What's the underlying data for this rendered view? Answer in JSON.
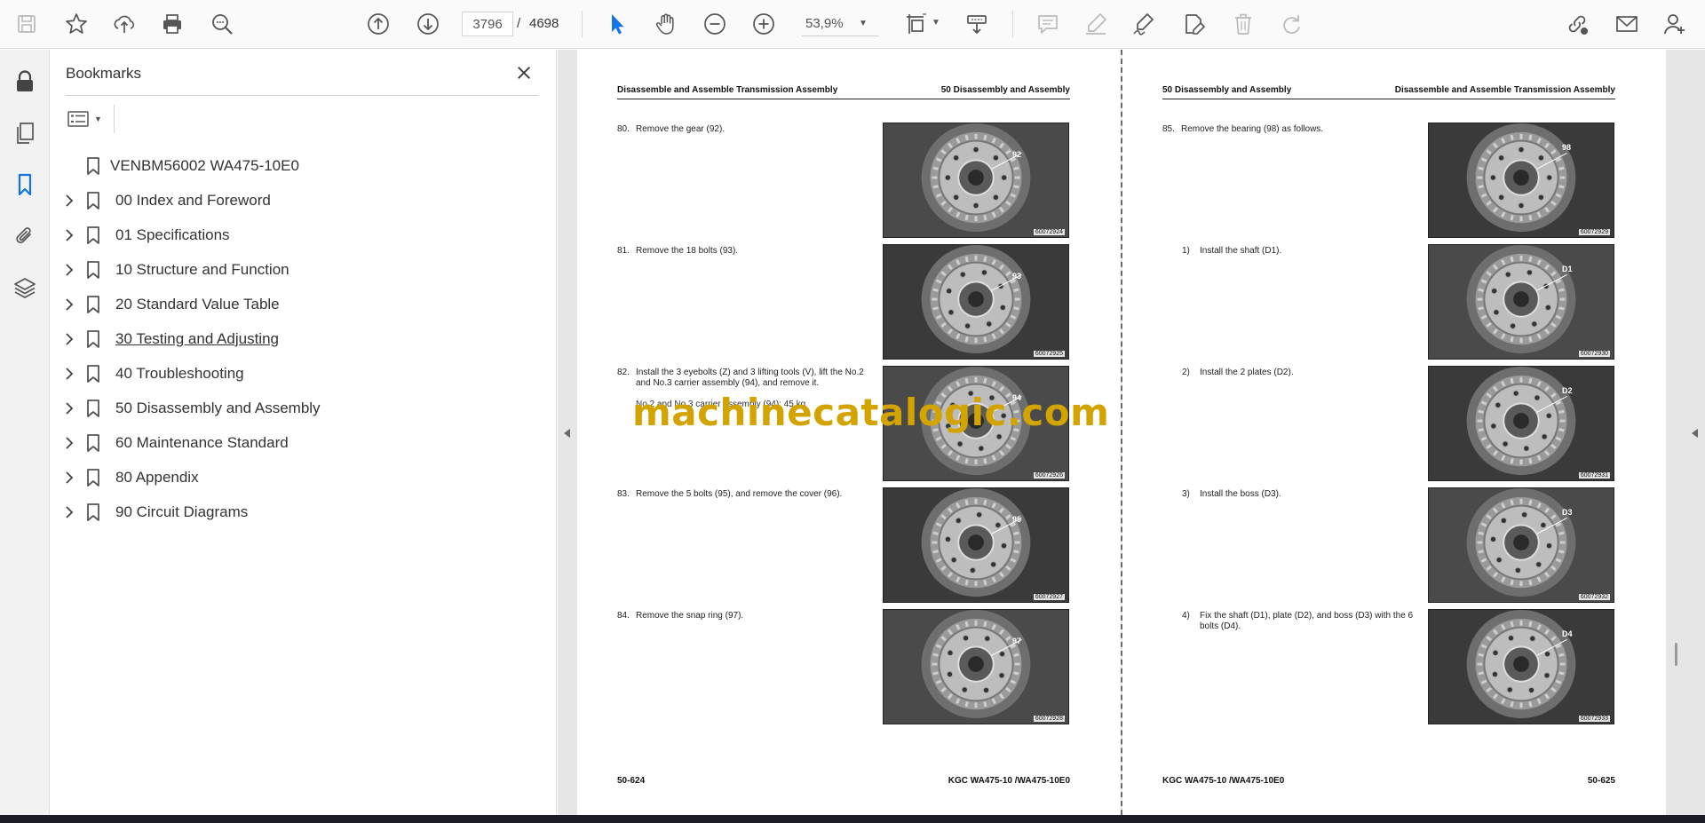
{
  "toolbar": {
    "icons": [
      "save-icon",
      "star-icon",
      "upload-icon",
      "print-icon",
      "zoom-search-icon",
      "page-up-icon",
      "page-down-icon",
      "select-cursor-icon",
      "hand-icon",
      "zoom-out-icon",
      "zoom-in-icon",
      "fit-page-icon",
      "scroll-mode-icon",
      "comment-icon",
      "highlight-icon",
      "sign-icon",
      "edit-text-icon",
      "delete-icon",
      "redo-icon",
      "share-link-icon",
      "email-icon",
      "account-icon"
    ],
    "current_page": "3796",
    "page_separator": "/",
    "total_pages": "4698",
    "zoom": "53,9%"
  },
  "rail": {
    "icons": [
      "lock-icon",
      "copy-pages-icon",
      "bookmark-icon",
      "attachment-icon",
      "layers-icon"
    ],
    "active": "bookmark-icon"
  },
  "bookmarks": {
    "title": "Bookmarks",
    "root": "VENBM56002 WA475-10E0",
    "items": [
      "00 Index and Foreword",
      "01 Specifications",
      "10 Structure and Function",
      "20 Standard Value Table",
      "30 Testing and Adjusting",
      "40 Troubleshooting",
      "50 Disassembly and Assembly",
      "60 Maintenance Standard",
      "80 Appendix",
      "90 Circuit Diagrams"
    ],
    "hovered_index": 4
  },
  "left_page": {
    "header_left": "Disassemble and Assemble Transmission Assembly",
    "header_right": "50 Disassembly and Assembly",
    "footer_left": "50-624",
    "footer_right": "KGC WA475-10 /WA475-10E0",
    "steps": [
      {
        "num": "80.",
        "text": "Remove the gear (92).",
        "photo_code": "60072924",
        "label": "92"
      },
      {
        "num": "81.",
        "text": "Remove the 18 bolts (93).",
        "photo_code": "60072925",
        "label": "93"
      },
      {
        "num": "82.",
        "text": "Install the 3 eyebolts (Z) and 3 lifting tools (V), lift the No.2 and No.3 carrier assembly (94), and remove it.",
        "note": "No.2 and No.3 carrier assembly (94): 45 kg",
        "photo_code": "60072926",
        "label": "94"
      },
      {
        "num": "83.",
        "text": "Remove the 5 bolts (95), and remove the cover (96).",
        "photo_code": "60072927",
        "label": "95"
      },
      {
        "num": "84.",
        "text": "Remove the snap ring (97).",
        "photo_code": "60072928",
        "label": "97"
      }
    ]
  },
  "right_page": {
    "header_left": "50 Disassembly and Assembly",
    "header_right": "Disassemble and Assemble Transmission Assembly",
    "footer_left": "KGC WA475-10 /WA475-10E0",
    "footer_right": "50-625",
    "steps": [
      {
        "num": "85.",
        "text": "Remove the bearing (98) as follows.",
        "photo_code": "60072929",
        "label": "98"
      },
      {
        "num": "1)",
        "text": "Install the shaft (D1).",
        "photo_code": "60072930",
        "label": "D1"
      },
      {
        "num": "2)",
        "text": "Install the 2 plates (D2).",
        "photo_code": "60072931",
        "label": "D2"
      },
      {
        "num": "3)",
        "text": "Install the boss (D3).",
        "photo_code": "60072932",
        "label": "D3"
      },
      {
        "num": "4)",
        "text": "Fix the shaft (D1), plate (D2), and boss (D3) with the 6 bolts (D4).",
        "photo_code": "60072933",
        "label": "D4"
      }
    ]
  },
  "watermark": "machinecatalogic.com"
}
